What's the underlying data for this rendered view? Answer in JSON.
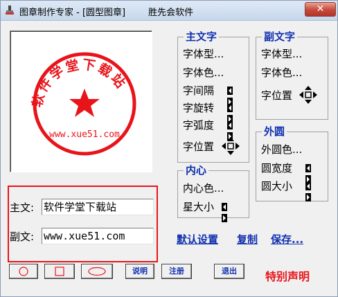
{
  "window": {
    "title": "图章制作专家 - [圆型图章]        胜先会软件",
    "close_label": "✕"
  },
  "seal": {
    "main_text": "软件学堂下载站",
    "sub_text": "www.xue51.com",
    "color": "#e8141a"
  },
  "main_text_group": {
    "title": "主文字",
    "font_type": "字体型...",
    "font_color": "字体色...",
    "spacing": "字间隔",
    "rotation": "字旋转",
    "arc": "字弧度",
    "position": "字位置"
  },
  "sub_text_group": {
    "title": "副文字",
    "font_type": "字体型...",
    "font_color": "字体色...",
    "position": "字位置"
  },
  "center_group": {
    "title": "内心",
    "inner_color": "内心色...",
    "star_size": "星大小"
  },
  "outer_group": {
    "title": "外圆",
    "outer_color": "外圆色...",
    "ring_width": "圆宽度",
    "circle_size": "圆大小"
  },
  "form": {
    "main_label": "主文:",
    "main_value": "软件学堂下载站",
    "sub_label": "副文:",
    "sub_value": "www.xue51.com"
  },
  "actions": {
    "default_settings": "默认设置",
    "copy": "复制",
    "save": "保存..."
  },
  "buttons": {
    "help": "说明",
    "register": "注册",
    "exit": "退出"
  },
  "notice": "特别声明",
  "colors": {
    "accent": "#1030b0",
    "stamp_red": "#e8141a"
  }
}
